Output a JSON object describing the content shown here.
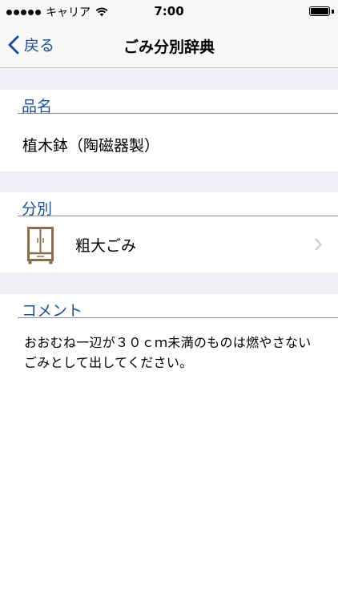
{
  "status_bar": {
    "carrier": "キャリア",
    "time": "7:00",
    "signal_dots": 5
  },
  "nav": {
    "back_label": "戻る",
    "title": "ごみ分別辞典"
  },
  "sections": {
    "item": {
      "header": "品名",
      "value": "植木鉢（陶磁器製）"
    },
    "category": {
      "header": "分別",
      "value": "粗大ごみ",
      "icon": "cabinet-icon"
    },
    "comment": {
      "header": "コメント",
      "text": "おおむね一辺が３０ｃｍ未満のものは燃やさないごみとして出してください。"
    }
  },
  "colors": {
    "accent": "#1f4e9c",
    "group_background": "#efeff4",
    "icon_brown": "#8b6e4e"
  }
}
